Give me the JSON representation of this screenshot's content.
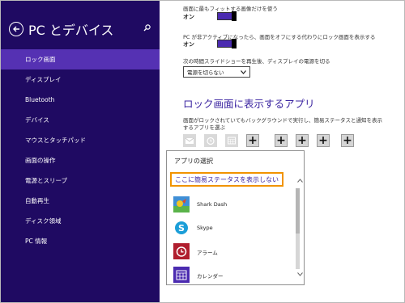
{
  "sidebar": {
    "title": "PC とデバイス",
    "items": [
      {
        "label": "ロック画面",
        "active": true
      },
      {
        "label": "ディスプレイ"
      },
      {
        "label": "Bluetooth"
      },
      {
        "label": "デバイス"
      },
      {
        "label": "マウスとタッチパッド"
      },
      {
        "label": "画面の操作"
      },
      {
        "label": "電源とスリープ"
      },
      {
        "label": "自動再生"
      },
      {
        "label": "ディスク領域"
      },
      {
        "label": "PC 情報"
      }
    ]
  },
  "main": {
    "fit_label": "画面に最もフィットする画像だけを使う",
    "fit_state": "オン",
    "inactive_label": "PC が非アクティブになったら、画面をオフにする代わりにロック画面を表示する",
    "inactive_state": "オン",
    "slideshow_label": "次の時間スライドショーを再生後、ディスプレイの電源を切る",
    "power_select": "電源を切らない",
    "lock_apps_title": "ロック画面に表示するアプリ",
    "lock_apps_desc": "画面がロックされていてもバックグラウンドで実行し、簡易ステータスと通知を表示するアプリを選ぶ",
    "add_symbol": "+"
  },
  "popup": {
    "title": "アプリの選択",
    "none_option": "ここに簡易ステータスを表示しない",
    "apps": [
      {
        "name": "Shark Dash",
        "icon": "shark-dash-icon",
        "color": "#3f8fd6"
      },
      {
        "name": "Skype",
        "icon": "skype-icon",
        "color": "#1b9ed8"
      },
      {
        "name": "アラーム",
        "icon": "alarm-icon",
        "color": "#b01e2e"
      },
      {
        "name": "カレンダー",
        "icon": "calendar-icon",
        "color": "#4b2bb0"
      }
    ]
  },
  "colors": {
    "sidebar_bg": "#1f0a62",
    "sidebar_active": "#5531b3",
    "accent": "#3a23a0",
    "highlight_border": "#f19300"
  }
}
